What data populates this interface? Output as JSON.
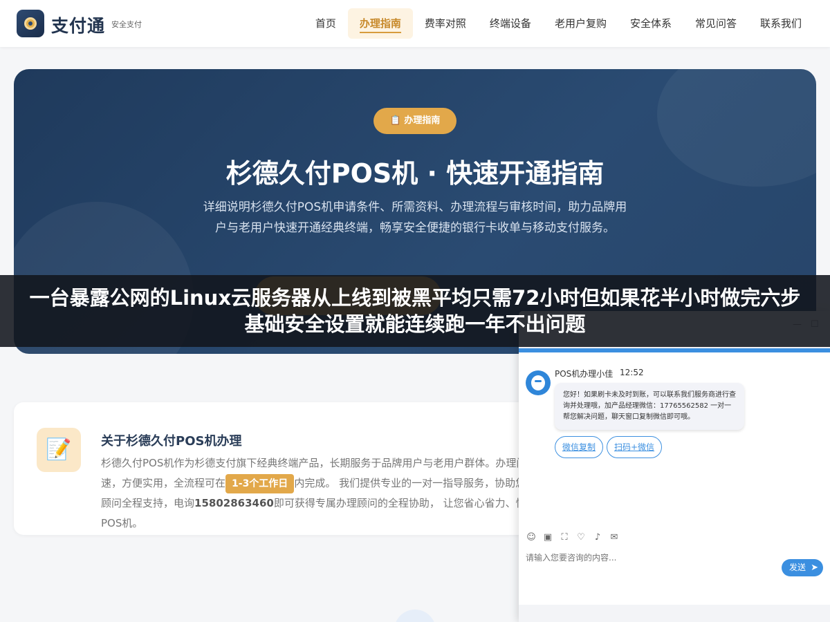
{
  "header": {
    "logo_text": "支付通",
    "logo_sub": "安全支付",
    "nav": [
      {
        "label": "首页"
      },
      {
        "label": "办理指南"
      },
      {
        "label": "费率对照"
      },
      {
        "label": "终端设备"
      },
      {
        "label": "老用户复购"
      },
      {
        "label": "安全体系"
      },
      {
        "label": "常见问答"
      },
      {
        "label": "联系我们"
      }
    ],
    "active_index": 1
  },
  "hero": {
    "badge": "📋 办理指南",
    "title": "杉德久付POS机 · 快速开通指南",
    "desc": "详细说明杉德久付POS机申请条件、所需资料、办理流程与审核时间，助力品牌用户与老用户快速开通经典终端，畅享安全便捷的银行卡收单与移动支付服务。"
  },
  "overlay": {
    "text": "一台暴露公网的Linux云服务器从上线到被黑平均只需72小时但如果花半小时做完六步基础安全设置就能连续跑一年不出问题"
  },
  "about": {
    "icon": "📝",
    "title": "关于杉德久付POS机办理",
    "text_1": "杉德久付POS机作为杉德支付旗下经典终端产品，长期服务于品牌用户与老用户群体。办理门槛低，审核快速，方便实用，全流程可在",
    "highlight": "1-3个工作日",
    "text_2": "内完成。 我们提供专业的一对一指导服务，协助您准备资料，专属顾问全程支持，电询",
    "phone": "15802863460",
    "text_3": "即可获得专属办理顾问的全程协助， 让您省心省力、快速开通杉德久付POS机。"
  },
  "chat": {
    "agent_name": "POS机办理小佳",
    "time": "12:52",
    "message": "您好！如果刷卡未及时到账，可以联系我们服务商进行查询并处理哦，加产品经理微信：17765562582 一对一帮您解决问题，聊天窗口复制微信即可哦。",
    "quick_replies": [
      "微信复制",
      "扫码+微信"
    ],
    "input_placeholder": "请输入您要咨询的内容...",
    "send_label": "发送"
  }
}
